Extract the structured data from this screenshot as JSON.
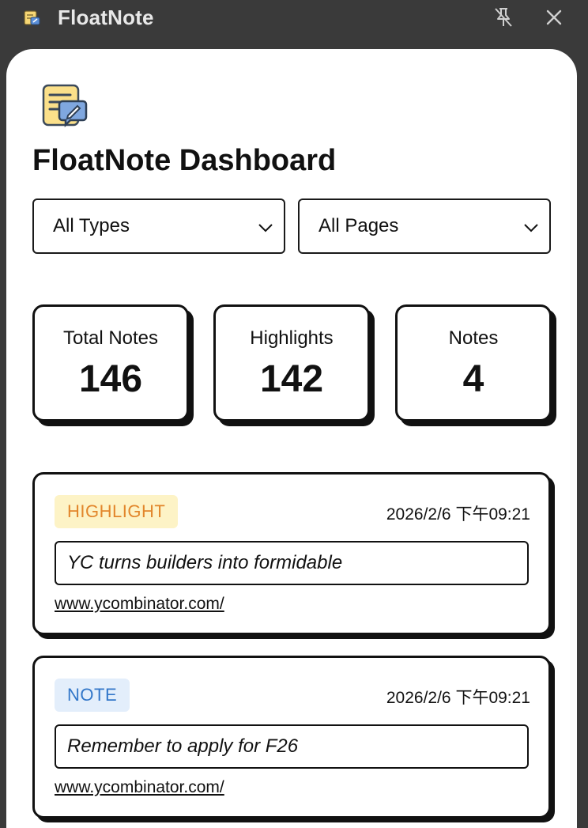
{
  "window": {
    "title": "FloatNote",
    "unpin_icon": "unpin-icon",
    "close_icon": "close-icon"
  },
  "dashboard": {
    "title": "FloatNote Dashboard"
  },
  "filters": {
    "type_selected": "All Types",
    "page_selected": "All Pages"
  },
  "stats": [
    {
      "label": "Total Notes",
      "value": "146"
    },
    {
      "label": "Highlights",
      "value": "142"
    },
    {
      "label": "Notes",
      "value": "4"
    }
  ],
  "notes": [
    {
      "type": "HIGHLIGHT",
      "timestamp": "2026/2/6 下午09:21",
      "text": "YC turns builders into formidable",
      "url": "www.ycombinator.com/"
    },
    {
      "type": "NOTE",
      "timestamp": "2026/2/6 下午09:21",
      "text": "Remember to apply for F26",
      "url": "www.ycombinator.com/"
    }
  ],
  "colors": {
    "highlight_badge_bg": "#fdf3c6",
    "highlight_badge_text": "#e2862b",
    "note_badge_bg": "#e3eefb",
    "note_badge_text": "#3377c9",
    "titlebar_bg": "#3a3a3a"
  }
}
